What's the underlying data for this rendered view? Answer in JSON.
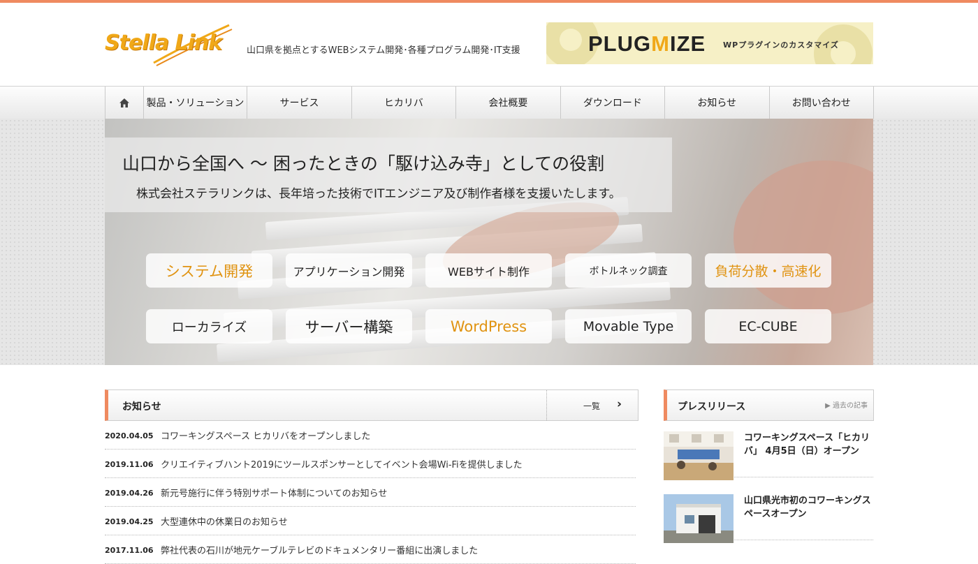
{
  "header": {
    "logo_text": "Stella Link",
    "tagline": "山口県を拠点とするWEBシステム開発･各種プログラム開発･IT支援",
    "banner": {
      "title_pre": "PLUG",
      "title_mid": "M",
      "title_post": "IZE",
      "subtitle": "WPプラグインのカスタマイズ"
    }
  },
  "nav": {
    "home_icon": "home-icon",
    "items": [
      "製品・ソリューション",
      "サービス",
      "ヒカリバ",
      "会社概要",
      "ダウンロード",
      "お知らせ",
      "お問い合わせ"
    ]
  },
  "hero": {
    "headline": "山口から全国へ 〜 困ったときの「駆け込み寺」としての役割",
    "subline": "株式会社ステラリンクは、長年培った技術でITエンジニア及び制作者様を支援いたします。",
    "services": [
      "システム開発",
      "アプリケーション開発",
      "WEBサイト制作",
      "ボトルネック調査",
      "負荷分散・高速化",
      "ローカライズ",
      "サーバー構築",
      "WordPress",
      "Movable Type",
      "EC-CUBE"
    ]
  },
  "news": {
    "title": "お知らせ",
    "more_label": "一覧",
    "items": [
      {
        "date": "2020.04.05",
        "text": "コワーキングスペース ヒカリバをオープンしました"
      },
      {
        "date": "2019.11.06",
        "text": "クリエイティブハント2019にツールスポンサーとしてイベント会場Wi-Fiを提供しました"
      },
      {
        "date": "2019.04.26",
        "text": "新元号施行に伴う特別サポート体制についてのお知らせ"
      },
      {
        "date": "2019.04.25",
        "text": "大型連休中の休業日のお知らせ"
      },
      {
        "date": "2017.11.06",
        "text": "弊社代表の石川が地元ケーブルテレビのドキュメンタリー番組に出演しました"
      }
    ]
  },
  "press": {
    "title": "プレスリリース",
    "more_label": "▶ 過去の記事",
    "items": [
      {
        "text": "コワーキングスペース「ヒカリバ」 4月5日（日）オープン"
      },
      {
        "text": "山口県光市初のコワーキングスペースオープン"
      }
    ]
  },
  "colors": {
    "accent": "#ef8a60",
    "logo_yellow": "#f0a818",
    "service_orange": "#e09311"
  }
}
